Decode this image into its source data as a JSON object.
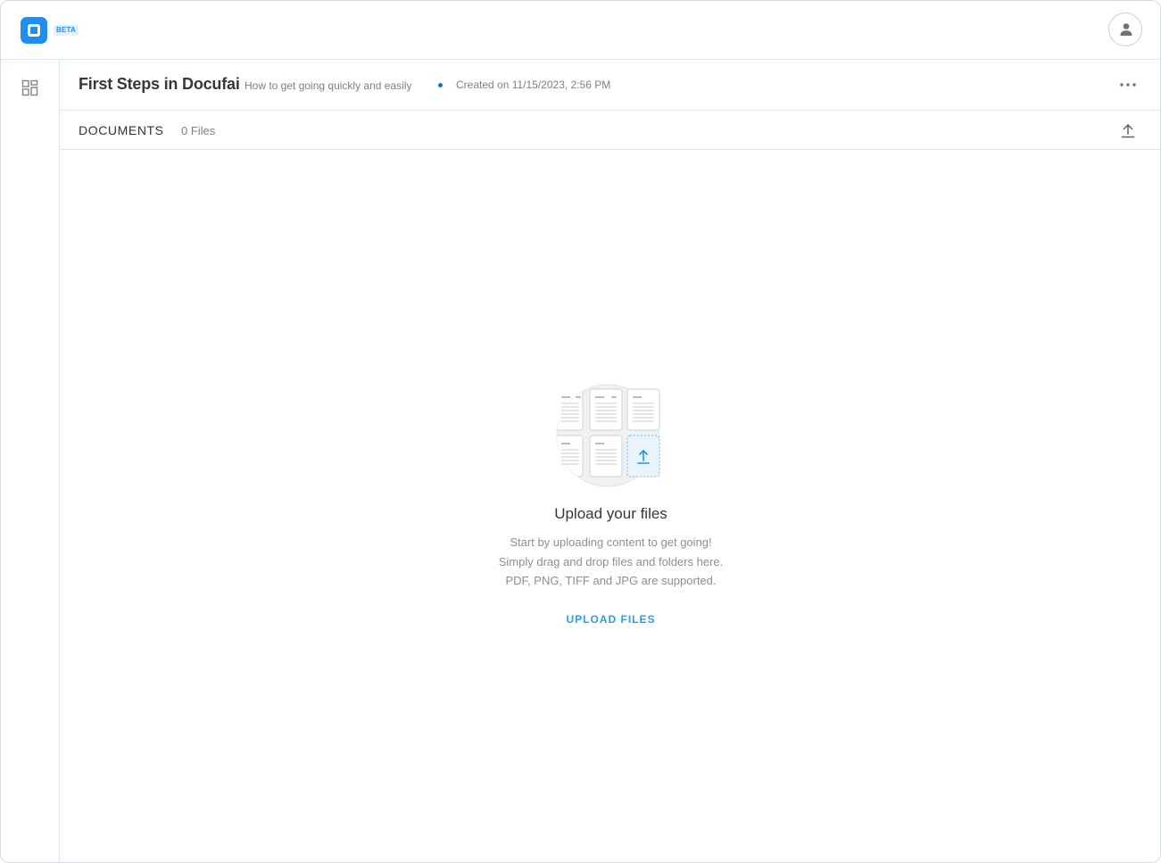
{
  "topbar": {
    "logo_icon": "docufai-logo-icon",
    "badge": "BETA",
    "avatar_icon": "user-icon",
    "accent_color": "#1f8ef1"
  },
  "sidebar": {
    "items": [
      {
        "icon": "dashboard-grid-icon"
      }
    ]
  },
  "project": {
    "title": "First Steps in Docufai",
    "subtitle": "How to get going quickly and easily",
    "created": "Created on 11/15/2023, 2:56 PM",
    "menu_icon": "more-horizontal-icon"
  },
  "documents": {
    "label": "DOCUMENTS",
    "count": "0 Files",
    "upload_icon": "upload-icon"
  },
  "empty_state": {
    "illustration_icon": "documents-upload-illustration",
    "title": "Upload your files",
    "lines": [
      "Start by uploading content to get going!",
      "Simply drag and drop files and folders here.",
      "PDF, PNG, TIFF and JPG are supported."
    ],
    "action": "UPLOAD FILES",
    "link_color": "#2d9be6"
  }
}
